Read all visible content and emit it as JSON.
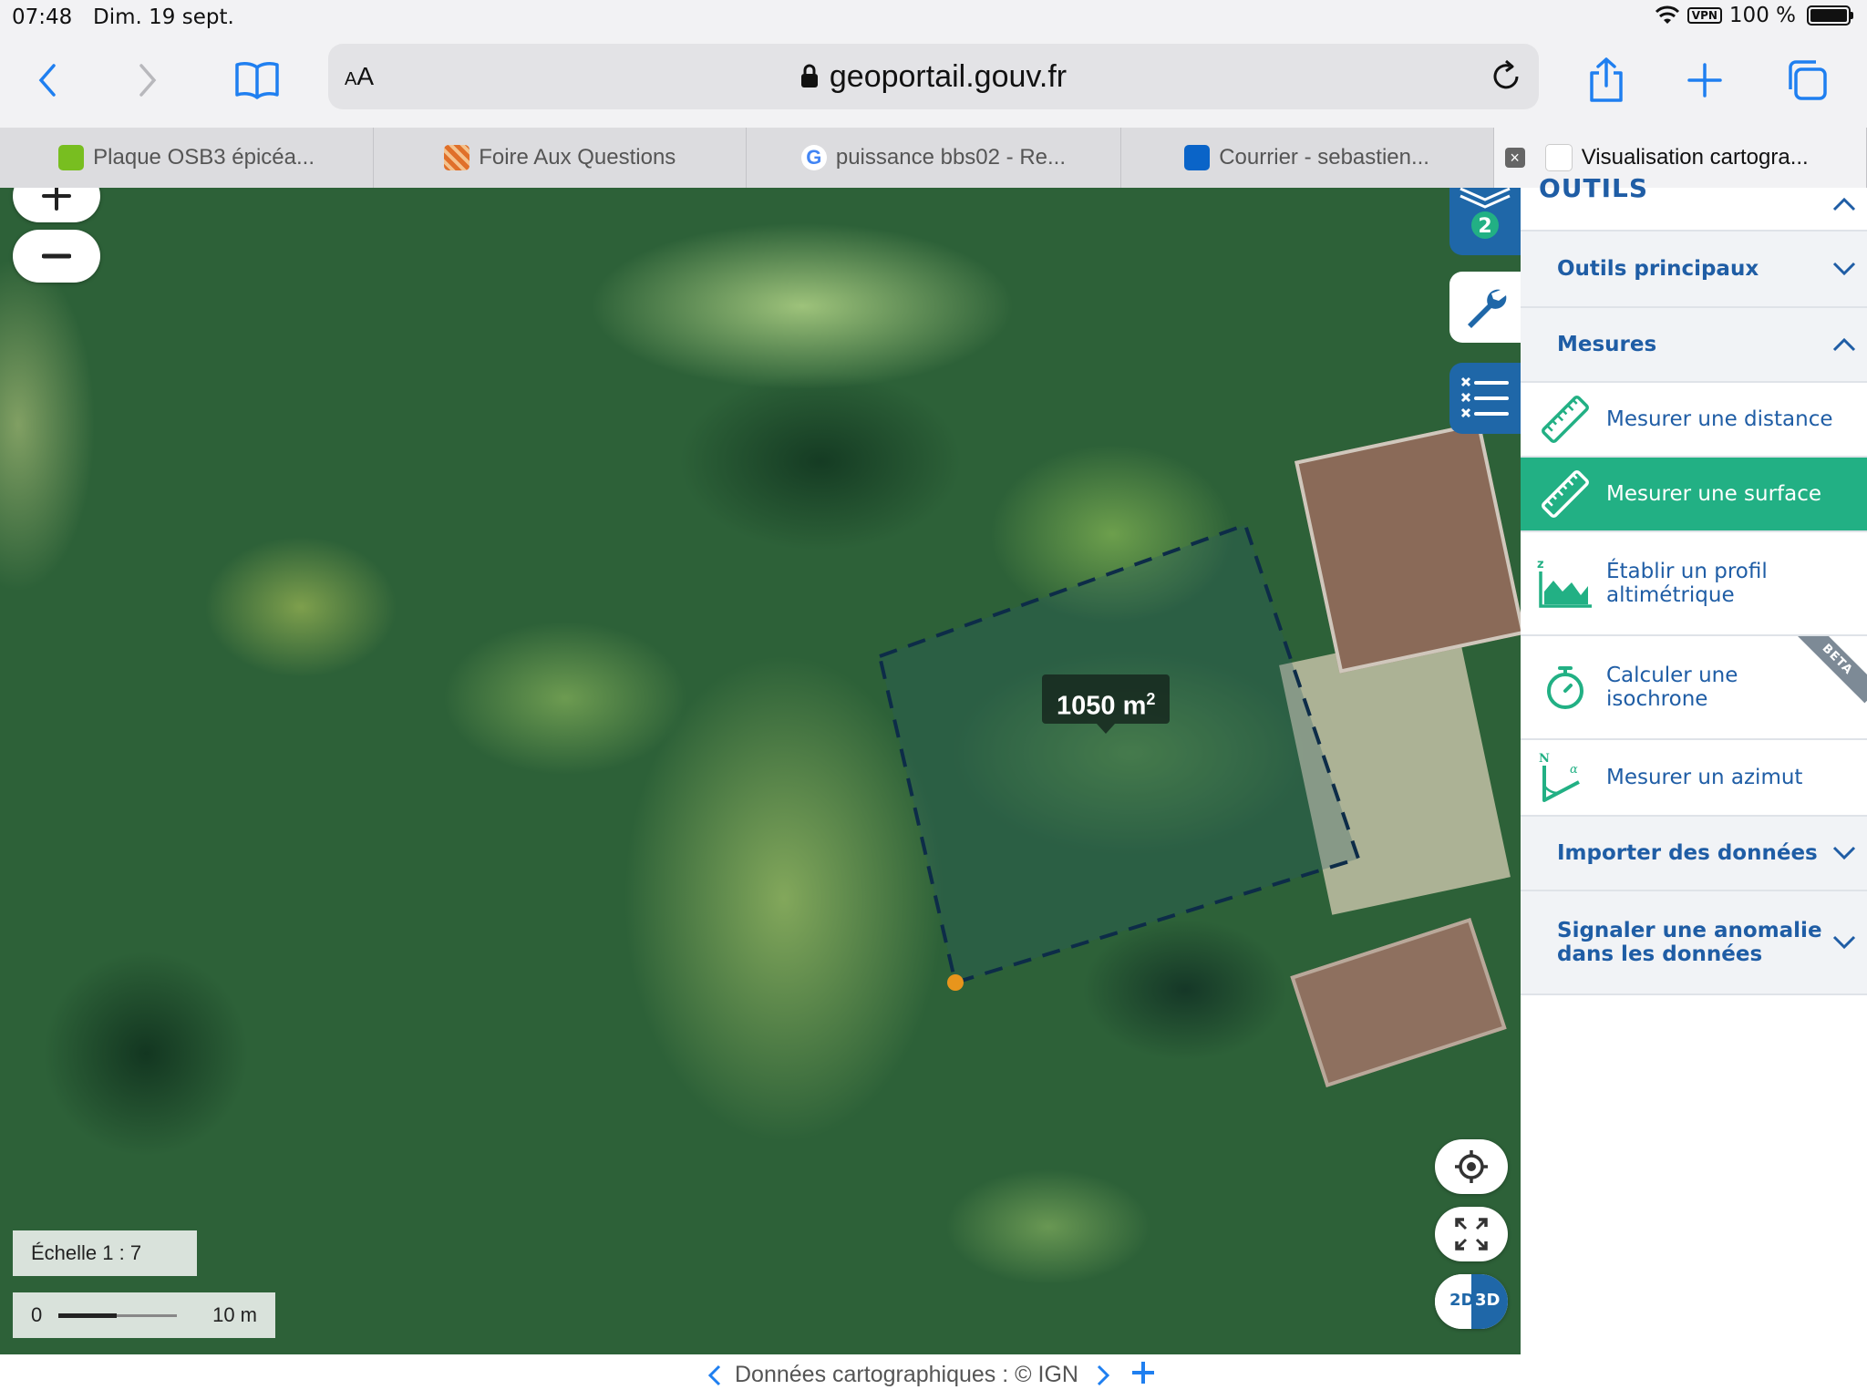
{
  "status_bar": {
    "time": "07:48",
    "date": "Dim. 19 sept.",
    "vpn": "VPN",
    "battery": "100 %"
  },
  "toolbar": {
    "text_size_label_small": "A",
    "text_size_label_large": "A",
    "url": "geoportail.gouv.fr"
  },
  "tabs": [
    {
      "label": "Plaque OSB3 épicéa...",
      "icon": "leroy-merlin-icon",
      "color": "#78be20"
    },
    {
      "label": "Foire Aux Questions",
      "icon": "striped-logo-icon",
      "color": "#e0702a"
    },
    {
      "label": "puissance bbs02 - Re...",
      "icon": "google-icon",
      "color": "#4285f4"
    },
    {
      "label": "Courrier - sebastien...",
      "icon": "outlook-icon",
      "color": "#0a64c8"
    },
    {
      "label": "Visualisation cartogra...",
      "icon": "geoportail-icon",
      "active": true
    }
  ],
  "map": {
    "measurement_value": "1050 m",
    "measurement_exponent": "2",
    "layers_badge": "2",
    "scale_label": "Échelle 1 :  7  ",
    "scale_zero": "0",
    "scale_distance": "10 m",
    "view_2d": "2D",
    "view_3d": "3D"
  },
  "panel": {
    "title": "OUTILS",
    "sections": {
      "outils_principaux": "Outils principaux",
      "mesures": "Mesures",
      "importer": "Importer des données",
      "signaler_line1": "Signaler une anomalie",
      "signaler_line2": "dans les données"
    },
    "items": {
      "distance": "Mesurer une distance",
      "surface": "Mesurer une surface",
      "profil_line1": "Établir un profil",
      "profil_line2": "altimétrique",
      "isochrone_line1": "Calculer une",
      "isochrone_line2": "isochrone",
      "azimut": "Mesurer un azimut"
    },
    "beta": "BETA",
    "accent": "#1f5da5",
    "selected_color": "#22b084"
  },
  "footer": {
    "attribution": "Données cartographiques : © IGN"
  }
}
